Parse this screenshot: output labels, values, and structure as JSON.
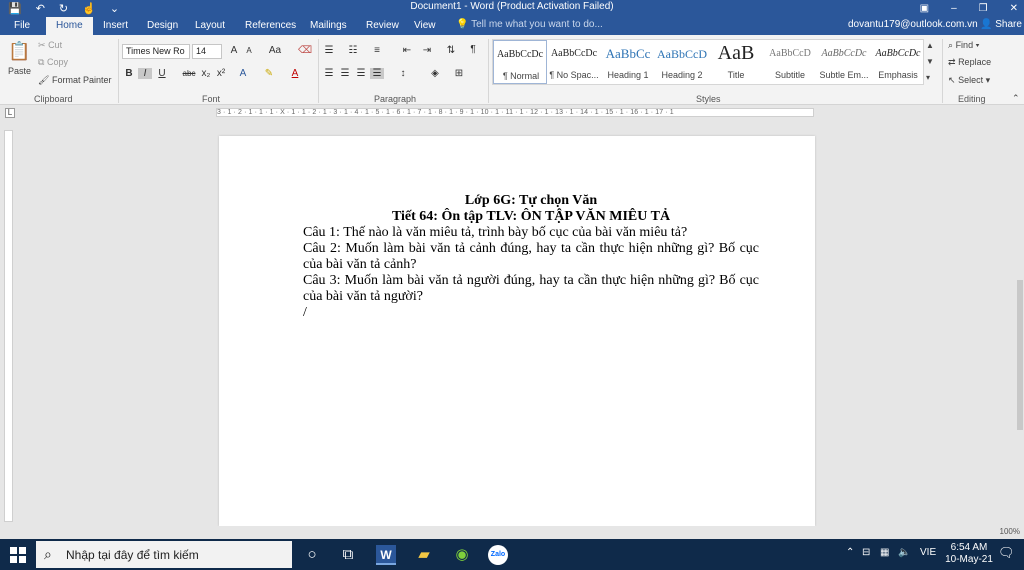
{
  "titlebar": {
    "title": "Document1 - Word (Product Activation Failed)",
    "minimize": "–",
    "maximize": "❐",
    "close": "✕"
  },
  "tabs": {
    "file": "File",
    "home": "Home",
    "insert": "Insert",
    "design": "Design",
    "layout": "Layout",
    "references": "References",
    "mailings": "Mailings",
    "review": "Review",
    "view": "View"
  },
  "tellme": "Tell me what you want to do...",
  "account": "dovantu179@outlook.com.vn",
  "share": "Share",
  "clipboard": {
    "paste": "Paste",
    "cut": "Cut",
    "copy": "Copy",
    "format_painter": "Format Painter",
    "label": "Clipboard"
  },
  "font": {
    "name": "Times New Ro",
    "size": "14",
    "label": "Font",
    "bold": "B",
    "italic": "I",
    "underline": "U",
    "strike": "abc",
    "subscript": "x₂",
    "superscript": "x²",
    "grow": "A",
    "shrink": "A",
    "case": "Aa"
  },
  "paragraph": {
    "label": "Paragraph",
    "pilcrow": "¶"
  },
  "styles": {
    "label": "Styles",
    "items": [
      {
        "preview": "AaBbCcDc",
        "name": "¶ Normal"
      },
      {
        "preview": "AaBbCcDc",
        "name": "¶ No Spac..."
      },
      {
        "preview": "AaBbCc",
        "name": "Heading 1"
      },
      {
        "preview": "AaBbCcD",
        "name": "Heading 2"
      },
      {
        "preview": "AaB",
        "name": "Title"
      },
      {
        "preview": "AaBbCcD",
        "name": "Subtitle"
      },
      {
        "preview": "AaBbCcDc",
        "name": "Subtle Em..."
      },
      {
        "preview": "AaBbCcDc",
        "name": "Emphasis"
      }
    ]
  },
  "editing": {
    "find": "Find",
    "replace": "Replace",
    "select": "Select",
    "label": "Editing"
  },
  "ruler_text": "3 · 1 · 2 · 1 · 1 · 1 · X · 1 · 1 · 2 · 1 · 3 · 1 · 4 · 1 · 5 · 1 · 6 · 1 · 7 · 1 · 8 · 1 · 9 · 1 · 10 · 1 · 11 · 1 · 12 · 1 · 13 · 1 · 14 · 1 · 15 · 1 · 16 · 1 · 17 · 1",
  "document": {
    "line1": "Lớp 6G: Tự chọn Văn",
    "line2": "Tiết 64: Ôn tập TLV: ÔN TẬP VĂN MIÊU TẢ",
    "q1": "Câu 1: Thế nào là văn miêu tả, trình bày bố cục của bài văn miêu tả?",
    "q2": "Câu 2: Muốn làm bài văn tả cảnh đúng, hay ta cần thực hiện những gì? Bố cục của bài văn tả cảnh?",
    "q3": "Câu 3: Muốn làm bài văn tả người đúng, hay ta cần thực hiện những gì? Bố cục của bài văn tả người?"
  },
  "zoom": "100%",
  "taskbar": {
    "search_placeholder": "Nhập tại đây để tìm kiếm",
    "lang": "VIE",
    "time": "6:54 AM",
    "date": "10-May-21"
  },
  "colors": {
    "word_blue": "#2b579a",
    "taskbar": "#0f2a4a"
  }
}
